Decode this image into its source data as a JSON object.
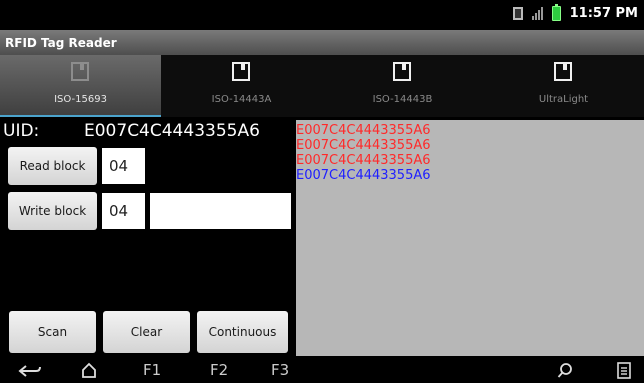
{
  "status_bar": {
    "time": "11:57 PM",
    "icons": [
      "notification-icon",
      "signal-icon",
      "battery-icon"
    ]
  },
  "app": {
    "title": "RFID Tag Reader"
  },
  "tabs": [
    {
      "label": "ISO-15693",
      "active": true
    },
    {
      "label": "ISO-14443A",
      "active": false
    },
    {
      "label": "ISO-14443B",
      "active": false
    },
    {
      "label": "UltraLight",
      "active": false
    }
  ],
  "uid": {
    "label": "UID:",
    "value": "E007C4C4443355A6"
  },
  "read": {
    "button_label": "Read block",
    "block": "04"
  },
  "write": {
    "button_label": "Write block",
    "block": "04",
    "data": ""
  },
  "actions": {
    "scan": "Scan",
    "clear": "Clear",
    "continuous": "Continuous"
  },
  "log": [
    {
      "text": "E007C4C4443355A6",
      "color": "#ff2a2a"
    },
    {
      "text": "E007C4C4443355A6",
      "color": "#ff2a2a"
    },
    {
      "text": "E007C4C4443355A6",
      "color": "#ff2a2a"
    },
    {
      "text": "E007C4C4443355A6",
      "color": "#2020ff"
    }
  ],
  "nav": {
    "f1": "F1",
    "f2": "F2",
    "f3": "F3"
  },
  "colors": {
    "accent": "#4ba3cc",
    "log_bg": "#b7b7b7"
  }
}
